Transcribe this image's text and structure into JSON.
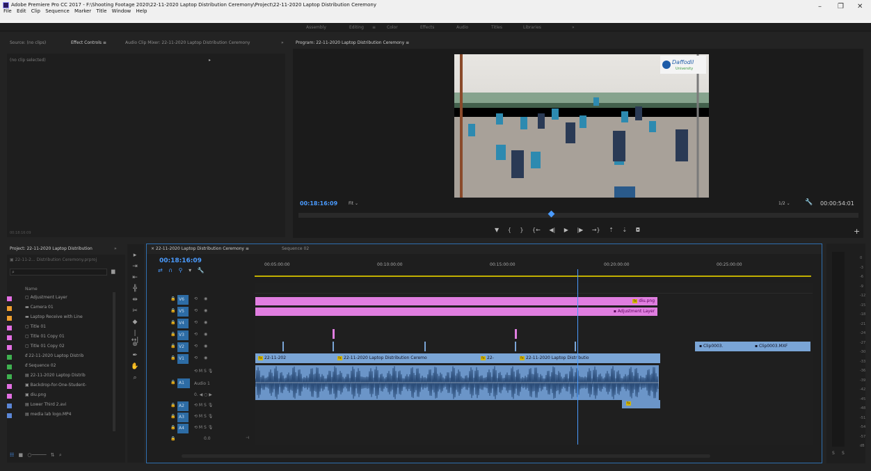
{
  "window": {
    "title": "Adobe Premiere Pro CC 2017 - F:\\Shooting Footage 2020\\22-11-2020 Laptop Distribution Ceremony\\Project\\22-11-2020 Laptop Distribution Ceremony",
    "menu": [
      "File",
      "Edit",
      "Clip",
      "Sequence",
      "Marker",
      "Title",
      "Window",
      "Help"
    ],
    "controls": {
      "minimize": "–",
      "maximize": "❐",
      "close": "✕"
    }
  },
  "workspaces": {
    "items": [
      "Assembly",
      "Editing",
      "≡",
      "Color",
      "Effects",
      "Audio",
      "Titles",
      "Libraries",
      "»"
    ],
    "active": "Editing"
  },
  "source_panel": {
    "tabs": [
      "Source: (no clips)",
      "Effect Controls  ≡",
      "Audio Clip Mixer: 22-11-2020 Laptop Distribution Ceremony"
    ],
    "more": "»",
    "no_clip": "(no clip selected)",
    "footer_time": "00:18:16:09"
  },
  "program_monitor": {
    "title": "Program: 22-11-2020 Laptop Distribution Ceremony  ≡",
    "timecode": "00:18:16:09",
    "fit": "Fit",
    "resolution": "1/2",
    "duration": "00:00:54:01",
    "banner_text": "Daffodil",
    "banner_sub": "University"
  },
  "project_panel": {
    "title": "Project: 22-11-2020 Laptop Distribution",
    "more": "»",
    "file": "22-11-2... Distribution Ceremony.prproj",
    "column": "Name",
    "items": [
      {
        "name": "Adjustment Layer",
        "color": "#e36fe3",
        "icon": "file-icon"
      },
      {
        "name": "Camera 01",
        "color": "#f0a030",
        "icon": "folder-icon"
      },
      {
        "name": "Laptop Receive with Line",
        "color": "#f0a030",
        "icon": "folder-icon"
      },
      {
        "name": "Title 01",
        "color": "#e36fe3",
        "icon": "file-icon"
      },
      {
        "name": "Title 01 Copy 01",
        "color": "#e36fe3",
        "icon": "file-icon"
      },
      {
        "name": "Title 01 Copy 02",
        "color": "#e36fe3",
        "icon": "file-icon"
      },
      {
        "name": "22-11-2020 Laptop Distrib",
        "color": "#3fb150",
        "icon": "sequence-icon"
      },
      {
        "name": "Sequence 02",
        "color": "#3fb150",
        "icon": "sequence-icon"
      },
      {
        "name": "22-11-2020 Laptop Distrib",
        "color": "#3fb150",
        "icon": "video-icon"
      },
      {
        "name": "Backdrop-for-One-Student-",
        "color": "#e36fe3",
        "icon": "image-icon"
      },
      {
        "name": "diu.png",
        "color": "#e36fe3",
        "icon": "image-icon"
      },
      {
        "name": "Lower Third 2.avi",
        "color": "#5b86d6",
        "icon": "video-icon"
      },
      {
        "name": "media lab logo.MP4",
        "color": "#5b86d6",
        "icon": "video-icon"
      }
    ]
  },
  "timeline": {
    "tabs": [
      "×  22-11-2020 Laptop Distribution Ceremony  ≡",
      "Sequence 02"
    ],
    "timecode": "00:18:16:09",
    "ruler": [
      "00:05:00:00",
      "00:10:00:00",
      "00:15:00:00",
      "00:20:00:00",
      "00:25:00:00"
    ],
    "video_tracks": [
      "V6",
      "V5",
      "V4",
      "V3",
      "V2",
      "V1"
    ],
    "audio_tracks": [
      "A1",
      "A2",
      "A3",
      "A4"
    ],
    "audio1_name": "Audio 1",
    "master": "0.0",
    "clips": {
      "v6": "diu.png",
      "v5": "Adjustment Layer",
      "v1_a": "22-11-202",
      "v1_b": "22-11-2020 Laptop Distribution Ceremo",
      "v1_c": "22-",
      "v1_d": "22-11-2020 Laptop Distributio",
      "v1_e": "Clip0003.",
      "v1_f": "Clip0003.MXF"
    },
    "track_btns": {
      "lock": "🔒",
      "eye": "👁",
      "sync": "⟲",
      "m": "M",
      "s": "S",
      "mic": "🎙"
    }
  },
  "meters": [
    "0",
    "-3",
    "-6",
    "-9",
    "-12",
    "-15",
    "-18",
    "-21",
    "-24",
    "-27",
    "-30",
    "-33",
    "-36",
    "-39",
    "-42",
    "-45",
    "-48",
    "-51",
    "-54",
    "-57",
    "dB"
  ],
  "meter_footer": [
    "S",
    "S"
  ],
  "colors": {
    "accent": "#4a9bff",
    "video_clip": "#7aa5d6",
    "adjustment": "#e07ee0",
    "audio_clip": "#6b95c8"
  }
}
